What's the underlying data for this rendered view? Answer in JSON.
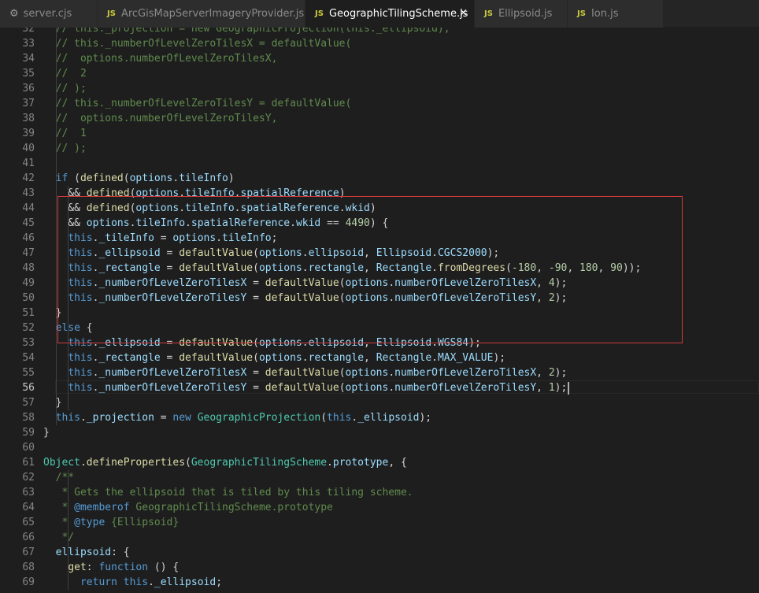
{
  "tabs": [
    {
      "label": "server.cjs",
      "icon": "gear-icon",
      "badge": "",
      "active": false
    },
    {
      "label": "ArcGisMapServerImageryProvider.js",
      "icon": "js-file-icon",
      "badge": "JS",
      "active": false
    },
    {
      "label": "GeographicTilingScheme.js",
      "icon": "js-file-icon",
      "badge": "JS",
      "active": true
    },
    {
      "label": "Ellipsoid.js",
      "icon": "js-file-icon",
      "badge": "JS",
      "active": false
    },
    {
      "label": "Ion.js",
      "icon": "js-file-icon",
      "badge": "JS",
      "active": false
    }
  ],
  "active_tab_close": "×",
  "editor": {
    "current_line": 56,
    "highlighted_block_lines": [
      42,
      51
    ],
    "lines": [
      {
        "n": 32,
        "s": [
          [
            "c",
            "// this._projection = new GeographicProjection(this._ellipsoid);"
          ]
        ]
      },
      {
        "n": 33,
        "s": [
          [
            "c",
            "// this._numberOfLevelZeroTilesX = defaultValue("
          ]
        ]
      },
      {
        "n": 34,
        "s": [
          [
            "c",
            "//  options.numberOfLevelZeroTilesX,"
          ]
        ]
      },
      {
        "n": 35,
        "s": [
          [
            "c",
            "//  2"
          ]
        ]
      },
      {
        "n": 36,
        "s": [
          [
            "c",
            "// );"
          ]
        ]
      },
      {
        "n": 37,
        "s": [
          [
            "c",
            "// this._numberOfLevelZeroTilesY = defaultValue("
          ]
        ]
      },
      {
        "n": 38,
        "s": [
          [
            "c",
            "//  options.numberOfLevelZeroTilesY,"
          ]
        ]
      },
      {
        "n": 39,
        "s": [
          [
            "c",
            "//  1"
          ]
        ]
      },
      {
        "n": 40,
        "s": [
          [
            "c",
            "// );"
          ]
        ]
      },
      {
        "n": 41,
        "s": []
      },
      {
        "n": 42,
        "s": [
          [
            "k",
            "if"
          ],
          [
            "p",
            " ("
          ],
          [
            "f",
            "defined"
          ],
          [
            "p",
            "("
          ],
          [
            "v",
            "options"
          ],
          [
            "p",
            "."
          ],
          [
            "v",
            "tileInfo"
          ],
          [
            "p",
            ")"
          ]
        ]
      },
      {
        "n": 43,
        "s": [
          [
            "p",
            "  && "
          ],
          [
            "f",
            "defined"
          ],
          [
            "p",
            "("
          ],
          [
            "v",
            "options"
          ],
          [
            "p",
            "."
          ],
          [
            "v",
            "tileInfo"
          ],
          [
            "p",
            "."
          ],
          [
            "v",
            "spatialReference"
          ],
          [
            "p",
            ")"
          ]
        ]
      },
      {
        "n": 44,
        "s": [
          [
            "p",
            "  && "
          ],
          [
            "f",
            "defined"
          ],
          [
            "p",
            "("
          ],
          [
            "v",
            "options"
          ],
          [
            "p",
            "."
          ],
          [
            "v",
            "tileInfo"
          ],
          [
            "p",
            "."
          ],
          [
            "v",
            "spatialReference"
          ],
          [
            "p",
            "."
          ],
          [
            "v",
            "wkid"
          ],
          [
            "p",
            ")"
          ]
        ]
      },
      {
        "n": 45,
        "s": [
          [
            "p",
            "  && "
          ],
          [
            "v",
            "options"
          ],
          [
            "p",
            "."
          ],
          [
            "v",
            "tileInfo"
          ],
          [
            "p",
            "."
          ],
          [
            "v",
            "spatialReference"
          ],
          [
            "p",
            "."
          ],
          [
            "v",
            "wkid"
          ],
          [
            "p",
            " == "
          ],
          [
            "n",
            "4490"
          ],
          [
            "p",
            ") {"
          ]
        ]
      },
      {
        "n": 46,
        "s": [
          [
            "p",
            "  "
          ],
          [
            "k",
            "this"
          ],
          [
            "p",
            "."
          ],
          [
            "v",
            "_tileInfo"
          ],
          [
            "p",
            " = "
          ],
          [
            "v",
            "options"
          ],
          [
            "p",
            "."
          ],
          [
            "v",
            "tileInfo"
          ],
          [
            "p",
            ";"
          ]
        ]
      },
      {
        "n": 47,
        "s": [
          [
            "p",
            "  "
          ],
          [
            "k",
            "this"
          ],
          [
            "p",
            "."
          ],
          [
            "v",
            "_ellipsoid"
          ],
          [
            "p",
            " = "
          ],
          [
            "f",
            "defaultValue"
          ],
          [
            "p",
            "("
          ],
          [
            "v",
            "options"
          ],
          [
            "p",
            "."
          ],
          [
            "v",
            "ellipsoid"
          ],
          [
            "p",
            ", "
          ],
          [
            "v",
            "Ellipsoid"
          ],
          [
            "p",
            "."
          ],
          [
            "v",
            "CGCS2000"
          ],
          [
            "p",
            ");"
          ]
        ]
      },
      {
        "n": 48,
        "s": [
          [
            "p",
            "  "
          ],
          [
            "k",
            "this"
          ],
          [
            "p",
            "."
          ],
          [
            "v",
            "_rectangle"
          ],
          [
            "p",
            " = "
          ],
          [
            "f",
            "defaultValue"
          ],
          [
            "p",
            "("
          ],
          [
            "v",
            "options"
          ],
          [
            "p",
            "."
          ],
          [
            "v",
            "rectangle"
          ],
          [
            "p",
            ", "
          ],
          [
            "v",
            "Rectangle"
          ],
          [
            "p",
            "."
          ],
          [
            "f",
            "fromDegrees"
          ],
          [
            "p",
            "("
          ],
          [
            "n",
            "-180"
          ],
          [
            "p",
            ", "
          ],
          [
            "n",
            "-90"
          ],
          [
            "p",
            ", "
          ],
          [
            "n",
            "180"
          ],
          [
            "p",
            ", "
          ],
          [
            "n",
            "90"
          ],
          [
            "p",
            "));"
          ]
        ]
      },
      {
        "n": 49,
        "s": [
          [
            "p",
            "  "
          ],
          [
            "k",
            "this"
          ],
          [
            "p",
            "."
          ],
          [
            "v",
            "_numberOfLevelZeroTilesX"
          ],
          [
            "p",
            " = "
          ],
          [
            "f",
            "defaultValue"
          ],
          [
            "p",
            "("
          ],
          [
            "v",
            "options"
          ],
          [
            "p",
            "."
          ],
          [
            "v",
            "numberOfLevelZeroTilesX"
          ],
          [
            "p",
            ", "
          ],
          [
            "n",
            "4"
          ],
          [
            "p",
            ");"
          ]
        ]
      },
      {
        "n": 50,
        "s": [
          [
            "p",
            "  "
          ],
          [
            "k",
            "this"
          ],
          [
            "p",
            "."
          ],
          [
            "v",
            "_numberOfLevelZeroTilesY"
          ],
          [
            "p",
            " = "
          ],
          [
            "f",
            "defaultValue"
          ],
          [
            "p",
            "("
          ],
          [
            "v",
            "options"
          ],
          [
            "p",
            "."
          ],
          [
            "v",
            "numberOfLevelZeroTilesY"
          ],
          [
            "p",
            ", "
          ],
          [
            "n",
            "2"
          ],
          [
            "p",
            ");"
          ]
        ]
      },
      {
        "n": 51,
        "s": [
          [
            "p",
            "}"
          ]
        ]
      },
      {
        "n": 52,
        "s": [
          [
            "k",
            "else"
          ],
          [
            "p",
            " {"
          ]
        ]
      },
      {
        "n": 53,
        "s": [
          [
            "p",
            "  "
          ],
          [
            "k",
            "this"
          ],
          [
            "p",
            "."
          ],
          [
            "v",
            "_ellipsoid"
          ],
          [
            "p",
            " = "
          ],
          [
            "f",
            "defaultValue"
          ],
          [
            "p",
            "("
          ],
          [
            "v",
            "options"
          ],
          [
            "p",
            "."
          ],
          [
            "v",
            "ellipsoid"
          ],
          [
            "p",
            ", "
          ],
          [
            "v",
            "Ellipsoid"
          ],
          [
            "p",
            "."
          ],
          [
            "v",
            "WGS84"
          ],
          [
            "p",
            ");"
          ]
        ]
      },
      {
        "n": 54,
        "s": [
          [
            "p",
            "  "
          ],
          [
            "k",
            "this"
          ],
          [
            "p",
            "."
          ],
          [
            "v",
            "_rectangle"
          ],
          [
            "p",
            " = "
          ],
          [
            "f",
            "defaultValue"
          ],
          [
            "p",
            "("
          ],
          [
            "v",
            "options"
          ],
          [
            "p",
            "."
          ],
          [
            "v",
            "rectangle"
          ],
          [
            "p",
            ", "
          ],
          [
            "v",
            "Rectangle"
          ],
          [
            "p",
            "."
          ],
          [
            "v",
            "MAX_VALUE"
          ],
          [
            "p",
            ");"
          ]
        ]
      },
      {
        "n": 55,
        "s": [
          [
            "p",
            "  "
          ],
          [
            "k",
            "this"
          ],
          [
            "p",
            "."
          ],
          [
            "v",
            "_numberOfLevelZeroTilesX"
          ],
          [
            "p",
            " = "
          ],
          [
            "f",
            "defaultValue"
          ],
          [
            "p",
            "("
          ],
          [
            "v",
            "options"
          ],
          [
            "p",
            "."
          ],
          [
            "v",
            "numberOfLevelZeroTilesX"
          ],
          [
            "p",
            ", "
          ],
          [
            "n",
            "2"
          ],
          [
            "p",
            ");"
          ]
        ]
      },
      {
        "n": 56,
        "s": [
          [
            "p",
            "  "
          ],
          [
            "k",
            "this"
          ],
          [
            "p",
            "."
          ],
          [
            "v",
            "_numberOfLevelZeroTilesY"
          ],
          [
            "p",
            " = "
          ],
          [
            "f",
            "defaultValue"
          ],
          [
            "p",
            "("
          ],
          [
            "v",
            "options"
          ],
          [
            "p",
            "."
          ],
          [
            "v",
            "numberOfLevelZeroTilesY"
          ],
          [
            "p",
            ", "
          ],
          [
            "n",
            "1"
          ],
          [
            "p",
            ");"
          ]
        ]
      },
      {
        "n": 57,
        "s": [
          [
            "p",
            "}"
          ]
        ]
      },
      {
        "n": 58,
        "s": [
          [
            "k",
            "this"
          ],
          [
            "p",
            "."
          ],
          [
            "v",
            "_projection"
          ],
          [
            "p",
            " = "
          ],
          [
            "k",
            "new"
          ],
          [
            "p",
            " "
          ],
          [
            "t",
            "GeographicProjection"
          ],
          [
            "p",
            "("
          ],
          [
            "k",
            "this"
          ],
          [
            "p",
            "."
          ],
          [
            "v",
            "_ellipsoid"
          ],
          [
            "p",
            ");"
          ]
        ]
      },
      {
        "n": 59,
        "s": [
          [
            "p",
            "}"
          ]
        ]
      },
      {
        "n": 60,
        "s": []
      },
      {
        "n": 61,
        "s": [
          [
            "t",
            "Object"
          ],
          [
            "p",
            "."
          ],
          [
            "f",
            "defineProperties"
          ],
          [
            "p",
            "("
          ],
          [
            "t",
            "GeographicTilingScheme"
          ],
          [
            "p",
            "."
          ],
          [
            "v",
            "prototype"
          ],
          [
            "p",
            ", {"
          ]
        ]
      },
      {
        "n": 62,
        "s": [
          [
            "c",
            "/**"
          ]
        ]
      },
      {
        "n": 63,
        "s": [
          [
            "c",
            " * Gets the ellipsoid that is tiled by this tiling scheme."
          ]
        ]
      },
      {
        "n": 64,
        "s": [
          [
            "c",
            " * "
          ],
          [
            "dt",
            "@memberof"
          ],
          [
            "c",
            " GeographicTilingScheme.prototype"
          ]
        ]
      },
      {
        "n": 65,
        "s": [
          [
            "c",
            " * "
          ],
          [
            "dt",
            "@type"
          ],
          [
            "c",
            " {Ellipsoid}"
          ]
        ]
      },
      {
        "n": 66,
        "s": [
          [
            "c",
            " */"
          ]
        ]
      },
      {
        "n": 67,
        "s": [
          [
            "v",
            "ellipsoid"
          ],
          [
            "p",
            ": {"
          ]
        ]
      },
      {
        "n": 68,
        "s": [
          [
            "p",
            "  "
          ],
          [
            "f",
            "get"
          ],
          [
            "p",
            ": "
          ],
          [
            "k",
            "function"
          ],
          [
            "p",
            " () {"
          ]
        ]
      },
      {
        "n": 69,
        "s": [
          [
            "p",
            "    "
          ],
          [
            "k",
            "return"
          ],
          [
            "p",
            " "
          ],
          [
            "k",
            "this"
          ],
          [
            "p",
            "."
          ],
          [
            "v",
            "_ellipsoid"
          ],
          [
            "p",
            ";"
          ]
        ]
      }
    ]
  }
}
